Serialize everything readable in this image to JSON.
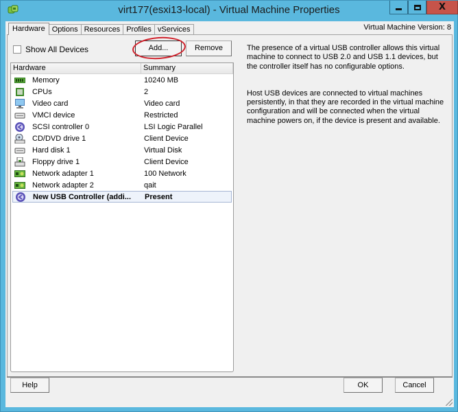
{
  "window": {
    "title": "virt177(esxi13-local) - Virtual Machine Properties",
    "icon": "vsphere-logo-icon",
    "controls": {
      "minimize": "minimize-icon",
      "maximize": "maximize-icon",
      "close_glyph": "X"
    }
  },
  "tabs": [
    {
      "label": "Hardware",
      "active": true
    },
    {
      "label": "Options",
      "active": false
    },
    {
      "label": "Resources",
      "active": false
    },
    {
      "label": "Profiles",
      "active": false
    },
    {
      "label": "vServices",
      "active": false
    }
  ],
  "vm_version": "Virtual Machine Version: 8",
  "toolbar": {
    "show_all_devices_label": "Show All Devices",
    "show_all_devices_checked": false,
    "add_label": "Add...",
    "remove_label": "Remove"
  },
  "hardware_list": {
    "columns": [
      "Hardware",
      "Summary"
    ],
    "rows": [
      {
        "icon": "memory-icon",
        "name": "Memory",
        "summary": "10240 MB"
      },
      {
        "icon": "cpu-icon",
        "name": "CPUs",
        "summary": "2"
      },
      {
        "icon": "monitor-icon",
        "name": "Video card",
        "summary": "Video card"
      },
      {
        "icon": "device-icon",
        "name": "VMCI device",
        "summary": "Restricted"
      },
      {
        "icon": "controller-icon",
        "name": "SCSI controller 0",
        "summary": "LSI Logic Parallel"
      },
      {
        "icon": "cd-drive-icon",
        "name": "CD/DVD drive 1",
        "summary": "Client Device"
      },
      {
        "icon": "hard-disk-icon",
        "name": "Hard disk 1",
        "summary": "Virtual Disk"
      },
      {
        "icon": "floppy-drive-icon",
        "name": "Floppy drive 1",
        "summary": "Client Device"
      },
      {
        "icon": "network-adapter-icon",
        "name": "Network adapter 1",
        "summary": "100 Network"
      },
      {
        "icon": "network-adapter-icon",
        "name": "Network adapter 2",
        "summary": "qait"
      },
      {
        "icon": "usb-controller-icon",
        "name": "New USB Controller (addi...",
        "summary": "Present",
        "selected": true
      }
    ]
  },
  "description": {
    "paragraphs": [
      "The presence of a virtual USB controller allows this virtual machine to connect to USB 2.0 and USB 1.1 devices,  but the controller itself has no configurable options.",
      "Host USB devices are connected to virtual machines persistently, in that they are recorded in the virtual machine configuration and will be connected when the virtual machine powers on, if the device is present and available."
    ]
  },
  "footer": {
    "help_label": "Help",
    "ok_label": "OK",
    "cancel_label": "Cancel"
  }
}
